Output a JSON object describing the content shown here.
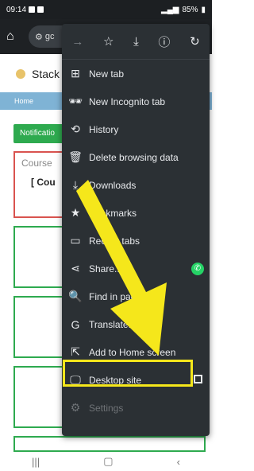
{
  "status": {
    "time": "09:14",
    "battery": "85%"
  },
  "topbar": {
    "url_snippet": "gc"
  },
  "page": {
    "site_title": "Stack",
    "breadcrumb": "Home",
    "notification_button": "Notificatio",
    "course_title": "Course",
    "course_sub": "[ Cou"
  },
  "menu": {
    "items": [
      {
        "icon": "new-tab-icon",
        "label": "New tab"
      },
      {
        "icon": "incognito-icon",
        "label": "New Incognito tab"
      },
      {
        "icon": "history-icon",
        "label": "History"
      },
      {
        "icon": "trash-icon",
        "label": "Delete browsing data"
      },
      {
        "icon": "download-icon",
        "label": "Downloads"
      },
      {
        "icon": "star-icon",
        "label": "Bookmarks"
      },
      {
        "icon": "recent-tabs-icon",
        "label": "Recent tabs"
      },
      {
        "icon": "share-icon",
        "label": "Share..."
      },
      {
        "icon": "find-icon",
        "label": "Find in page"
      },
      {
        "icon": "translate-icon",
        "label": "Translate..."
      },
      {
        "icon": "add-home-icon",
        "label": "Add to Home screen"
      },
      {
        "icon": "desktop-icon",
        "label": "Desktop site"
      },
      {
        "icon": "settings-icon",
        "label": "Settings"
      }
    ]
  },
  "colors": {
    "highlight": "#f5e71b",
    "menu_bg": "#2b3034",
    "green": "#2eaa4f"
  }
}
